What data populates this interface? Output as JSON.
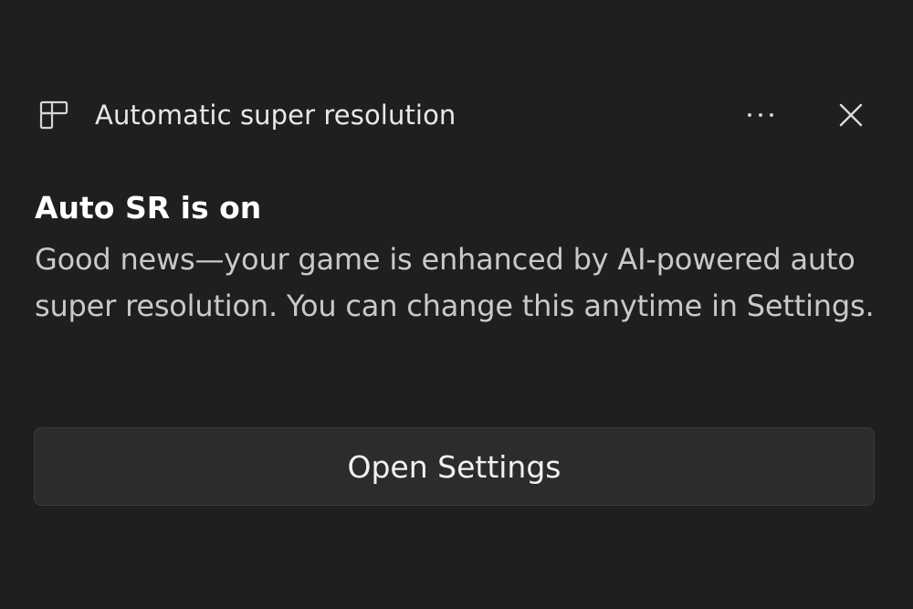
{
  "notification": {
    "app_icon": "widget-layout-icon",
    "app_title": "Automatic super resolution",
    "more_icon": "more-options-icon",
    "close_icon": "close-icon",
    "heading": "Auto SR is on",
    "body": "Good news—your game is enhanced by AI-powered auto super resolution. You can change this anytime in Settings.",
    "action_label": "Open Settings"
  },
  "colors": {
    "background": "#1f1f1f",
    "button_background": "#2c2c2c",
    "text_primary": "#ffffff",
    "text_secondary": "#c9c9c9"
  }
}
